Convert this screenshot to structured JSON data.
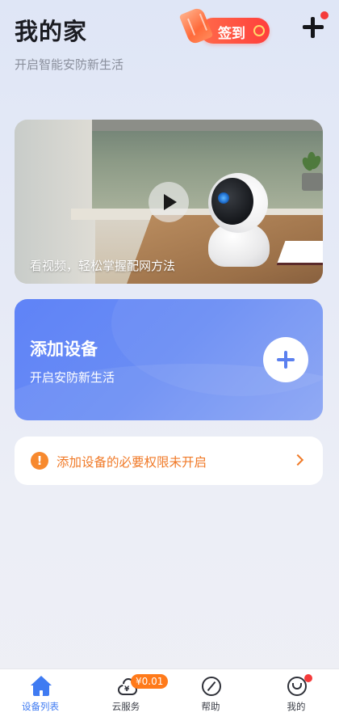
{
  "header": {
    "title": "我的家",
    "subtitle": "开启智能安防新生活",
    "signin_label": "签到",
    "add_icon": "plus-icon",
    "notification_dot": true
  },
  "video_card": {
    "caption": "看视频，轻松掌握配网方法",
    "play_icon": "play-icon"
  },
  "add_device_card": {
    "title": "添加设备",
    "subtitle": "开启安防新生活",
    "button_icon": "plus-icon"
  },
  "permission_banner": {
    "icon": "exclamation-icon",
    "text": "添加设备的必要权限未开启",
    "chevron": "chevron-right-icon",
    "color": "#f07a28"
  },
  "tabbar": {
    "tabs": [
      {
        "label": "设备列表",
        "icon": "home-icon",
        "active": true
      },
      {
        "label": "云服务",
        "icon": "cloud-icon",
        "badge": "¥0.01"
      },
      {
        "label": "帮助",
        "icon": "compass-icon"
      },
      {
        "label": "我的",
        "icon": "smile-icon",
        "dot": true
      }
    ],
    "active_color": "#3f7bf2"
  }
}
